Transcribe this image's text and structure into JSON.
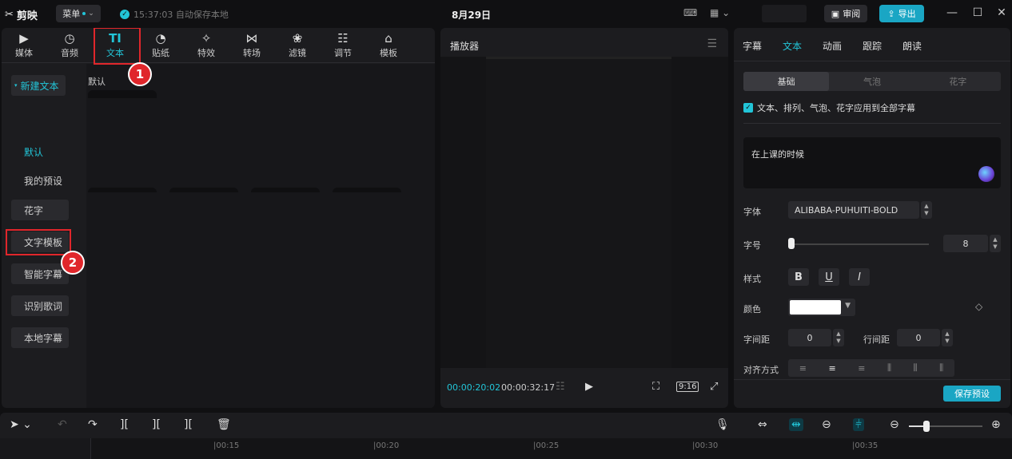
{
  "app": {
    "logo_text": "剪映",
    "menu_label": "菜单",
    "save_status": "15:37:03 自动保存本地",
    "title": "8月29日",
    "review_label": "审阅",
    "export_label": "导出"
  },
  "media_tabs": [
    {
      "label": "媒体",
      "icon": "media-icon"
    },
    {
      "label": "音频",
      "icon": "audio-icon"
    },
    {
      "label": "文本",
      "icon": "text-icon"
    },
    {
      "label": "贴纸",
      "icon": "sticker-icon"
    },
    {
      "label": "特效",
      "icon": "effects-icon"
    },
    {
      "label": "转场",
      "icon": "transition-icon"
    },
    {
      "label": "滤镜",
      "icon": "filter-icon"
    },
    {
      "label": "调节",
      "icon": "adjust-icon"
    },
    {
      "label": "模板",
      "icon": "template-icon"
    }
  ],
  "annotations": {
    "badge1": "1",
    "badge2": "2"
  },
  "sidebar": {
    "items": [
      {
        "label": "新建文本"
      },
      {
        "label": "默认"
      },
      {
        "label": "我的预设"
      },
      {
        "label": "花字"
      },
      {
        "label": "文字模板"
      },
      {
        "label": "智能字幕"
      },
      {
        "label": "识别歌词"
      },
      {
        "label": "本地字幕"
      }
    ]
  },
  "content": {
    "section_label": "默认"
  },
  "player": {
    "title": "播放器",
    "current_time": "00:00:20:02",
    "total_time": "00:00:32:17",
    "ratio": "9:16"
  },
  "inspector": {
    "tabs": [
      "字幕",
      "文本",
      "动画",
      "跟踪",
      "朗读"
    ],
    "segments": [
      "基础",
      "气泡",
      "花字"
    ],
    "apply_all_label": "文本、排列、气泡、花字应用到全部字幕",
    "text_content": "在上课的时候",
    "font_label": "字体",
    "font_value": "ALIBABA-PUHUITI-BOLD",
    "size_label": "字号",
    "size_value": "8",
    "style_label": "样式",
    "color_label": "颜色",
    "text_color": "#ffffff",
    "char_spacing_label": "字间距",
    "char_spacing_value": "0",
    "line_spacing_label": "行间距",
    "line_spacing_value": "0",
    "align_label": "对齐方式",
    "save_preset_label": "保存预设"
  },
  "timeline": {
    "ticks": [
      "|00:15",
      "|00:20",
      "|00:25",
      "|00:30",
      "|00:35"
    ]
  },
  "colors": {
    "accent": "#22c5d8",
    "highlight": "#e0262b",
    "export": "#1aa6c4"
  }
}
